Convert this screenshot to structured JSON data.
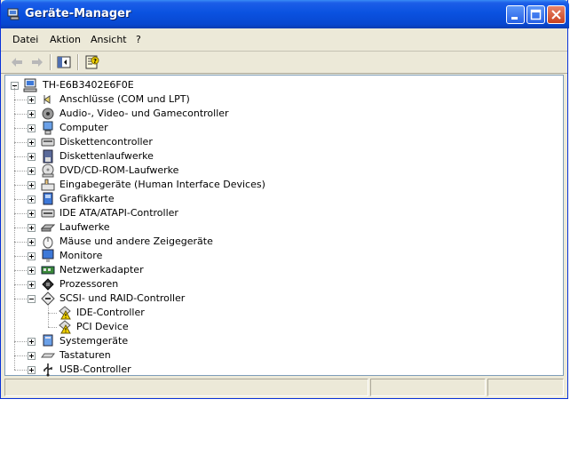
{
  "window": {
    "title": "Geräte-Manager"
  },
  "menu": [
    "Datei",
    "Aktion",
    "Ansicht",
    "?"
  ],
  "toolbar": {
    "back_icon": "back-arrow-icon",
    "forward_icon": "forward-arrow-icon",
    "view_icon": "show-hide-console-tree-icon",
    "props_icon": "properties-icon"
  },
  "tree": {
    "root": "TH-E6B3402E6F0E",
    "categories": [
      {
        "label": "Anschlüsse (COM und LPT)",
        "icon": "port-icon"
      },
      {
        "label": "Audio-, Video- und Gamecontroller",
        "icon": "audio-icon"
      },
      {
        "label": "Computer",
        "icon": "computer-icon"
      },
      {
        "label": "Diskettencontroller",
        "icon": "floppy-controller-icon"
      },
      {
        "label": "Diskettenlaufwerke",
        "icon": "floppy-drive-icon"
      },
      {
        "label": "DVD/CD-ROM-Laufwerke",
        "icon": "cdrom-icon"
      },
      {
        "label": "Eingabegeräte (Human Interface Devices)",
        "icon": "hid-icon"
      },
      {
        "label": "Grafikkarte",
        "icon": "display-adapter-icon"
      },
      {
        "label": "IDE ATA/ATAPI-Controller",
        "icon": "ide-controller-icon"
      },
      {
        "label": "Laufwerke",
        "icon": "disk-drive-icon"
      },
      {
        "label": "Mäuse und andere Zeigegeräte",
        "icon": "mouse-icon"
      },
      {
        "label": "Monitore",
        "icon": "monitor-icon"
      },
      {
        "label": "Netzwerkadapter",
        "icon": "network-adapter-icon"
      },
      {
        "label": "Prozessoren",
        "icon": "processor-icon"
      },
      {
        "label": "SCSI- und RAID-Controller",
        "icon": "scsi-icon",
        "expanded": true,
        "children": [
          {
            "label": "IDE-Controller",
            "icon": "warning-device-icon"
          },
          {
            "label": "PCI Device",
            "icon": "warning-device-icon"
          }
        ]
      },
      {
        "label": "Systemgeräte",
        "icon": "system-device-icon"
      },
      {
        "label": "Tastaturen",
        "icon": "keyboard-icon"
      },
      {
        "label": "USB-Controller",
        "icon": "usb-icon"
      }
    ]
  }
}
